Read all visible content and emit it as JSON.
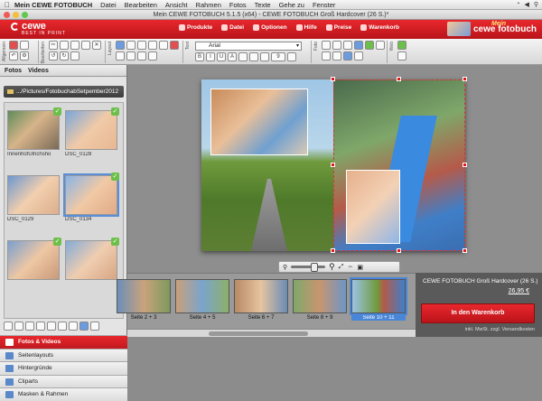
{
  "menubar": {
    "app_name": "Mein CEWE FOTOBUCH",
    "items": [
      "Datei",
      "Bearbeiten",
      "Ansicht",
      "Rahmen",
      "Fotos",
      "Texte",
      "Gehe zu",
      "Fenster"
    ]
  },
  "window": {
    "title": "Mein CEWE FOTOBUCH 5.1.5 (x64) - CEWE FOTOBUCH Groß Hardcover (26 S.)*"
  },
  "header": {
    "logo_text": "cewe",
    "logo_sub": "BEST IN PRINT",
    "nav": [
      {
        "label": "Produkte",
        "icon": "package-icon"
      },
      {
        "label": "Datei",
        "icon": "file-icon"
      },
      {
        "label": "Optionen",
        "icon": "gear-icon"
      },
      {
        "label": "Hilfe",
        "icon": "help-icon"
      },
      {
        "label": "Preise",
        "icon": "price-icon"
      },
      {
        "label": "Warenkorb",
        "icon": "cart-icon"
      }
    ],
    "brand_mein": "Mein",
    "brand_main": "cewe fotobuch"
  },
  "toolbar": {
    "group_labels": [
      "Allgemein",
      "Bearbeiten",
      "Layout",
      "Text",
      "Foto",
      "Web"
    ],
    "font_name": "Arial",
    "font_size": "9"
  },
  "left_panel": {
    "tab_photos": "Fotos",
    "tab_videos": "Videos",
    "folder_path": ".../Pictures/FotobuchabSetpember2012",
    "thumbnails": [
      {
        "caption": "InnenhofUlrichsho",
        "selected": false
      },
      {
        "caption": "DSC_0128",
        "selected": false
      },
      {
        "caption": "DSC_0129",
        "selected": false
      },
      {
        "caption": "DSC_0134",
        "selected": true
      },
      {
        "caption": "",
        "selected": false
      },
      {
        "caption": "",
        "selected": false
      }
    ],
    "nav_items": [
      {
        "label": "Fotos & Videos",
        "active": true
      },
      {
        "label": "Seitenlayouts",
        "active": false
      },
      {
        "label": "Hintergründe",
        "active": false
      },
      {
        "label": "Cliparts",
        "active": false
      },
      {
        "label": "Masken & Rahmen",
        "active": false
      }
    ]
  },
  "pages": [
    {
      "label": "Seite 2 + 3",
      "selected": false
    },
    {
      "label": "Seite 4 + 5",
      "selected": false
    },
    {
      "label": "Seite 6 + 7",
      "selected": false
    },
    {
      "label": "Seite 8 + 9",
      "selected": false
    },
    {
      "label": "Seite 10 + 11",
      "selected": true
    }
  ],
  "cart": {
    "product": "CEWE FOTOBUCH Groß Hardcover (26 S.)",
    "price": "26,95 €",
    "button": "In den Warenkorb",
    "vat_note": "inkl. MwSt. zzgl. Versandkosten"
  },
  "colors": {
    "brand_red": "#d81e24",
    "selection_blue": "#4a86d8",
    "check_green": "#6cbf4a"
  }
}
